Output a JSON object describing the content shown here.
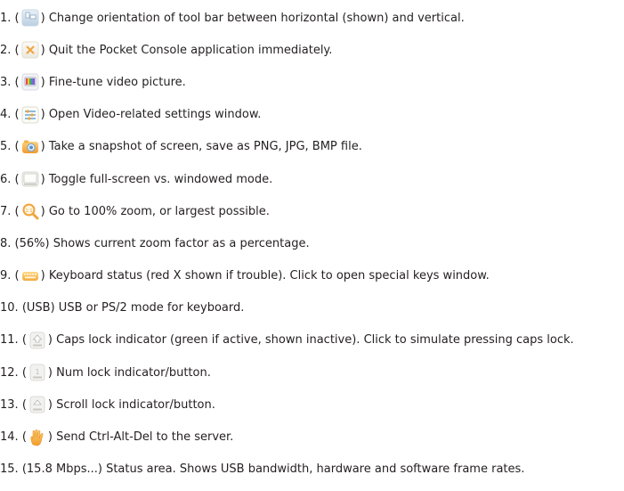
{
  "items": [
    {
      "num": "1.",
      "open": "(",
      "icon": "orientation-icon",
      "code": "",
      "text": ") Change orientation of tool bar between horizontal (shown) and vertical."
    },
    {
      "num": "2.",
      "open": "(",
      "icon": "quit-icon",
      "code": "",
      "text": ") Quit the Pocket Console application immediately."
    },
    {
      "num": "3.",
      "open": "(",
      "icon": "picture-adjust-icon",
      "code": "",
      "text": ") Fine-tune video picture."
    },
    {
      "num": "4.",
      "open": "(",
      "icon": "video-settings-icon",
      "code": "",
      "text": ") Open Video-related settings window."
    },
    {
      "num": "5.",
      "open": "(",
      "icon": "camera-icon",
      "code": "",
      "text": ") Take a snapshot of screen, save as PNG, JPG, BMP file."
    },
    {
      "num": "6.",
      "open": "(",
      "icon": "fullscreen-icon",
      "code": "",
      "text": ") Toggle full-screen vs. windowed mode."
    },
    {
      "num": "7.",
      "open": "(",
      "icon": "zoom-icon",
      "code": "",
      "text": ") Go to 100% zoom, or largest possible."
    },
    {
      "num": "8.",
      "open": "",
      "icon": "",
      "code": "(56%)",
      "text": " Shows current zoom factor as a percentage."
    },
    {
      "num": "9.",
      "open": "(",
      "icon": "keyboard-icon",
      "code": "",
      "text": ") Keyboard status (red X shown if trouble). Click to open special keys window."
    },
    {
      "num": "10.",
      "open": "",
      "icon": "",
      "code": "(USB)",
      "text": " USB or PS/2 mode for keyboard."
    },
    {
      "num": "11.",
      "open": "(",
      "icon": "caps-lock-icon",
      "code": "",
      "text": ") Caps lock indicator (green if active, shown inactive). Click to simulate pressing caps lock."
    },
    {
      "num": "12.",
      "open": "(",
      "icon": "num-lock-icon",
      "code": "",
      "text": ") Num lock indicator/button."
    },
    {
      "num": "13.",
      "open": "(",
      "icon": "scroll-lock-icon",
      "code": "",
      "text": ") Scroll lock indicator/button."
    },
    {
      "num": "14.",
      "open": "(",
      "icon": "ctrl-alt-del-hand-icon",
      "code": "",
      "text": ") Send Ctrl-Alt-Del to the server."
    },
    {
      "num": "15.",
      "open": "",
      "icon": "",
      "code": "(15.8 Mbps...)",
      "text": " Status area. Shows USB bandwidth, hardware and software frame rates."
    }
  ]
}
